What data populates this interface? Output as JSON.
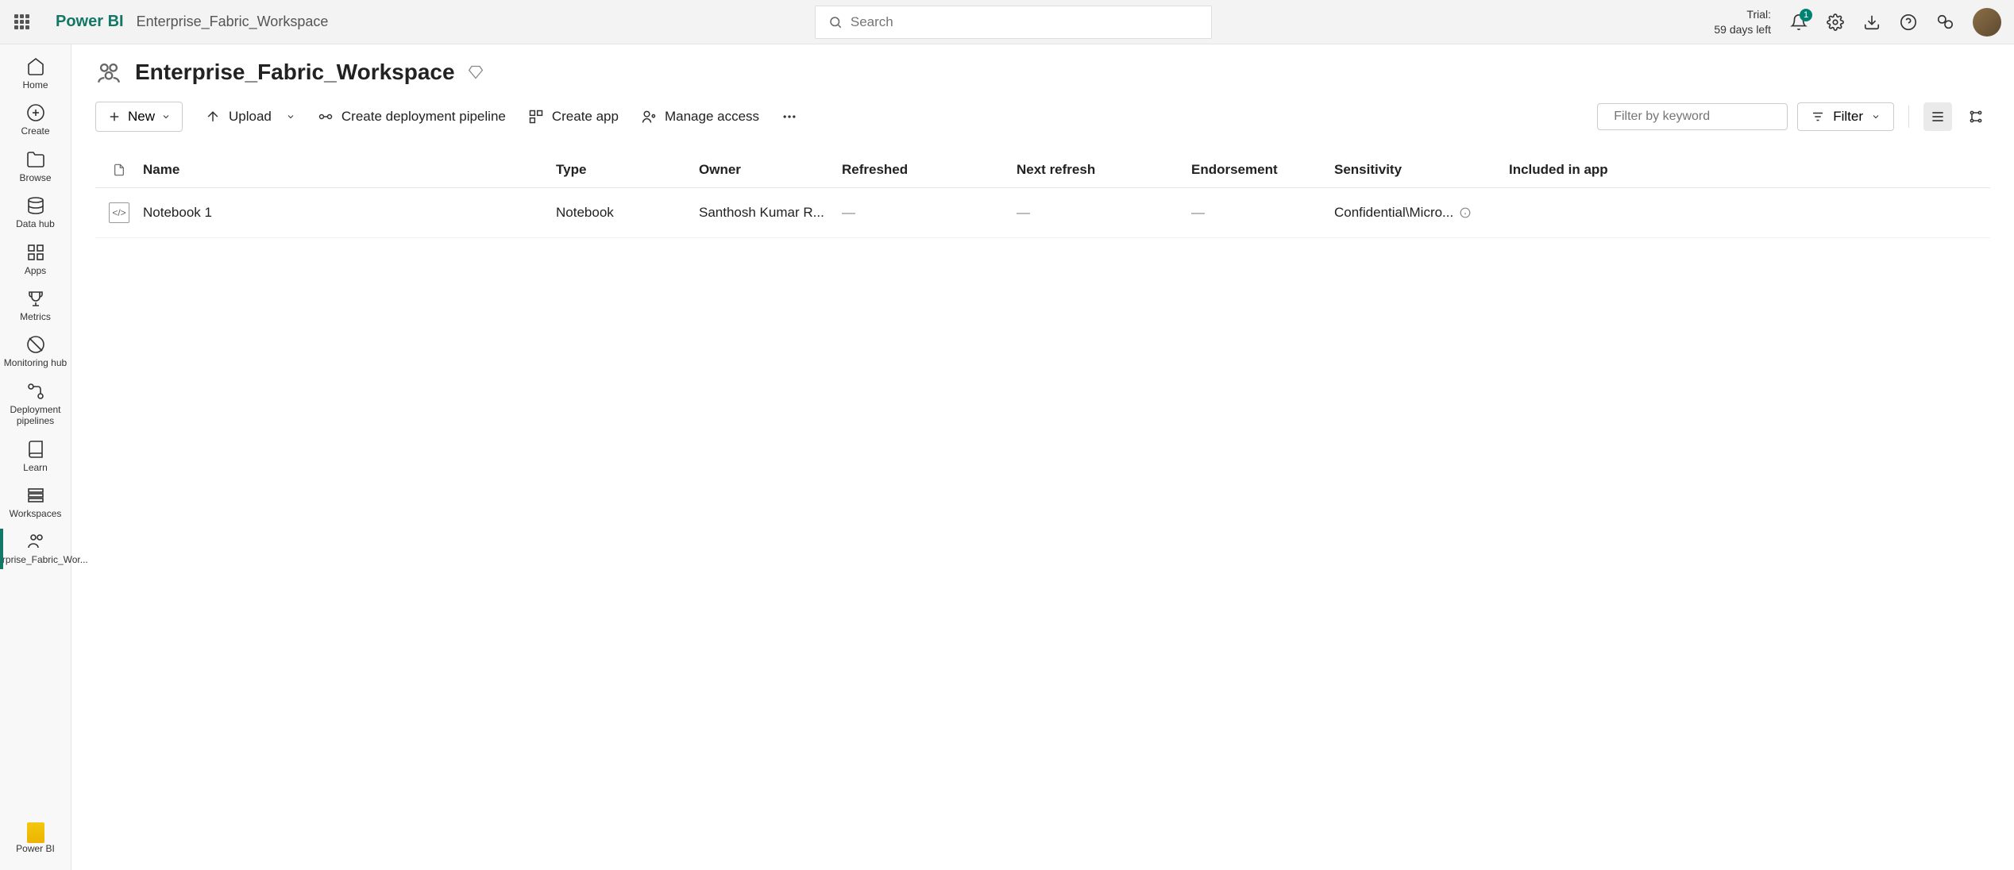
{
  "header": {
    "product": "Power BI",
    "breadcrumb": "Enterprise_Fabric_Workspace",
    "search_placeholder": "Search",
    "trial_label": "Trial:",
    "trial_days": "59 days left",
    "notification_count": "1"
  },
  "sidebar": {
    "items": [
      {
        "label": "Home"
      },
      {
        "label": "Create"
      },
      {
        "label": "Browse"
      },
      {
        "label": "Data hub"
      },
      {
        "label": "Apps"
      },
      {
        "label": "Metrics"
      },
      {
        "label": "Monitoring hub"
      },
      {
        "label": "Deployment pipelines"
      },
      {
        "label": "Learn"
      },
      {
        "label": "Workspaces"
      },
      {
        "label": "Enterprise_Fabric_Wor..."
      }
    ],
    "bottom_label": "Power BI"
  },
  "workspace": {
    "title": "Enterprise_Fabric_Workspace"
  },
  "toolbar": {
    "new_label": "New",
    "upload_label": "Upload",
    "pipeline_label": "Create deployment pipeline",
    "create_app_label": "Create app",
    "manage_access_label": "Manage access",
    "filter_placeholder": "Filter by keyword",
    "filter_button": "Filter"
  },
  "table": {
    "headers": {
      "name": "Name",
      "type": "Type",
      "owner": "Owner",
      "refreshed": "Refreshed",
      "next_refresh": "Next refresh",
      "endorsement": "Endorsement",
      "sensitivity": "Sensitivity",
      "included": "Included in app"
    },
    "rows": [
      {
        "name": "Notebook 1",
        "type": "Notebook",
        "owner": "Santhosh Kumar R...",
        "refreshed": "—",
        "next_refresh": "—",
        "endorsement": "—",
        "sensitivity": "Confidential\\Micro...",
        "included": ""
      }
    ]
  }
}
